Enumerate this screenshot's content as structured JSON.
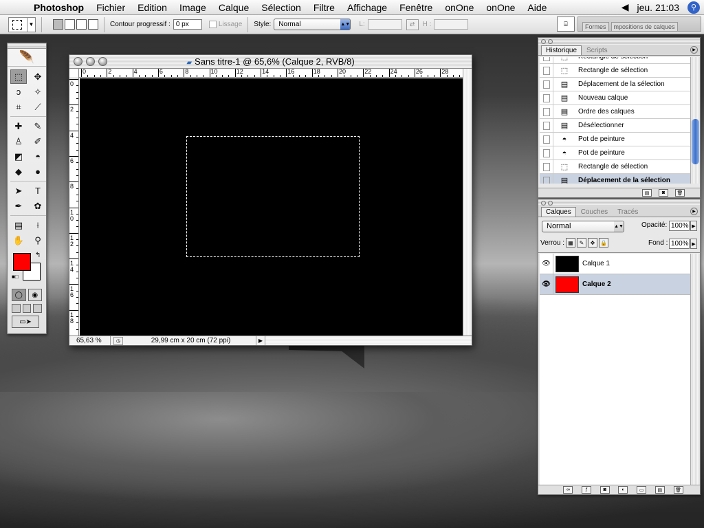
{
  "menubar": {
    "apple_glyph": "",
    "app_name": "Photoshop",
    "items": [
      "Fichier",
      "Edition",
      "Image",
      "Calque",
      "Sélection",
      "Filtre",
      "Affichage",
      "Fenêtre",
      "onOne",
      "onOne",
      "Aide"
    ],
    "clock": "jeu. 21:03",
    "speaker_icon": "speaker-icon",
    "spotlight_icon": "spotlight-icon"
  },
  "options_bar": {
    "feather_label": "Contour progressif :",
    "feather_value": "0 px",
    "antialias_label": "Lissage",
    "style_label": "Style:",
    "style_value": "Normal",
    "width_label": "L:",
    "height_label": "H :",
    "well_tabs": [
      "Formes",
      "mpositions de calques"
    ]
  },
  "tools": [
    {
      "name": "marquee-tool-icon",
      "glyph": "⬚",
      "active": true
    },
    {
      "name": "move-tool-icon",
      "glyph": "✥"
    },
    {
      "name": "lasso-tool-icon",
      "glyph": "ↄ"
    },
    {
      "name": "magic-wand-tool-icon",
      "glyph": "✧"
    },
    {
      "name": "crop-tool-icon",
      "glyph": "⌗"
    },
    {
      "name": "slice-tool-icon",
      "glyph": "⟋"
    },
    {
      "name": "healing-brush-tool-icon",
      "glyph": "✚"
    },
    {
      "name": "brush-tool-icon",
      "glyph": "✎"
    },
    {
      "name": "clone-stamp-tool-icon",
      "glyph": "♙"
    },
    {
      "name": "history-brush-tool-icon",
      "glyph": "✐"
    },
    {
      "name": "eraser-tool-icon",
      "glyph": "◩"
    },
    {
      "name": "paint-bucket-tool-icon",
      "glyph": "◓"
    },
    {
      "name": "blur-tool-icon",
      "glyph": "◆"
    },
    {
      "name": "dodge-tool-icon",
      "glyph": "●"
    },
    {
      "name": "path-selection-tool-icon",
      "glyph": "➤"
    },
    {
      "name": "type-tool-icon",
      "glyph": "T"
    },
    {
      "name": "pen-tool-icon",
      "glyph": "✒"
    },
    {
      "name": "custom-shape-tool-icon",
      "glyph": "✿"
    },
    {
      "name": "notes-tool-icon",
      "glyph": "▤"
    },
    {
      "name": "eyedropper-tool-icon",
      "glyph": "⟊"
    },
    {
      "name": "hand-tool-icon",
      "glyph": "✋"
    },
    {
      "name": "zoom-tool-icon",
      "glyph": "⚲"
    }
  ],
  "colors": {
    "foreground": "#ff0000",
    "background": "#ffffff",
    "accent": "#3e71c8"
  },
  "document": {
    "title": "Sans titre-1 @ 65,6% (Calque 2, RVB/8)",
    "zoom": "65,63 %",
    "size_info": "29,99 cm x 20 cm (72 ppi)",
    "ruler_h_labels": [
      "0",
      "2",
      "4",
      "6",
      "8",
      "10",
      "12",
      "14",
      "16",
      "18",
      "20",
      "22",
      "24",
      "26",
      "28"
    ],
    "ruler_v_labels": [
      "0",
      "2",
      "4",
      "6",
      "8",
      "1\n0",
      "1\n2",
      "1\n4",
      "1\n6",
      "1\n8"
    ]
  },
  "history_panel": {
    "tabs": [
      "Historique",
      "Scripts"
    ],
    "items": [
      {
        "label": "Rectangle de sélection",
        "icon": "marquee-icon",
        "glyph": "⬚"
      },
      {
        "label": "Rectangle de sélection",
        "icon": "marquee-icon",
        "glyph": "⬚"
      },
      {
        "label": "Déplacement de la sélection",
        "icon": "document-icon",
        "glyph": "▤"
      },
      {
        "label": "Nouveau calque",
        "icon": "document-icon",
        "glyph": "▤"
      },
      {
        "label": "Ordre des calques",
        "icon": "document-icon",
        "glyph": "▤"
      },
      {
        "label": "Désélectionner",
        "icon": "document-icon",
        "glyph": "▤"
      },
      {
        "label": "Pot de peinture",
        "icon": "paint-bucket-icon",
        "glyph": "◓"
      },
      {
        "label": "Pot de peinture",
        "icon": "paint-bucket-icon",
        "glyph": "◓"
      },
      {
        "label": "Rectangle de sélection",
        "icon": "marquee-icon",
        "glyph": "⬚"
      },
      {
        "label": "Déplacement de la sélection",
        "icon": "document-icon",
        "glyph": "▤",
        "current": true
      }
    ]
  },
  "layers_panel": {
    "tabs": [
      "Calques",
      "Couches",
      "Tracés"
    ],
    "blend_mode": "Normal",
    "opacity_label": "Opacité:",
    "opacity_value": "100%",
    "lock_label": "Verrou :",
    "fill_label": "Fond :",
    "fill_value": "100%",
    "layers": [
      {
        "name": "Calque 1",
        "color": "#000000",
        "current": false
      },
      {
        "name": "Calque 2",
        "color": "#ff0000",
        "current": true
      }
    ]
  }
}
